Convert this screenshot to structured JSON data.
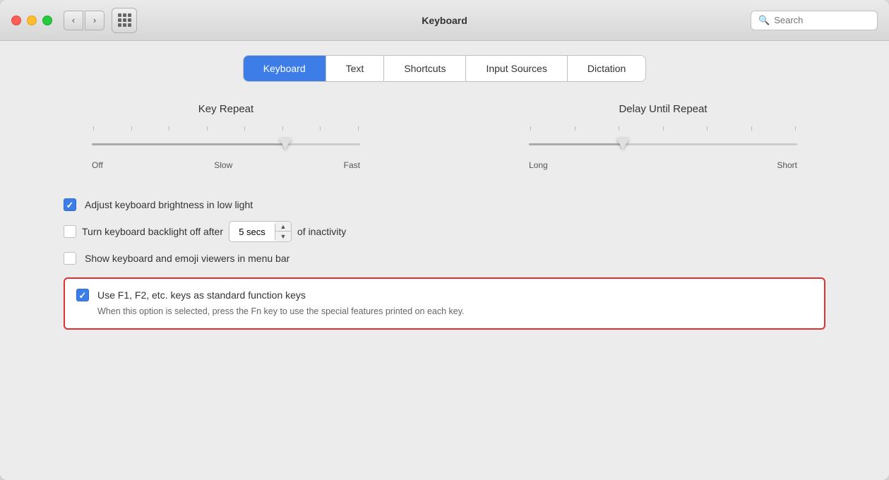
{
  "window": {
    "title": "Keyboard"
  },
  "titlebar": {
    "search_placeholder": "Search",
    "back_label": "<",
    "forward_label": ">"
  },
  "tabs": [
    {
      "id": "keyboard",
      "label": "Keyboard",
      "active": true
    },
    {
      "id": "text",
      "label": "Text",
      "active": false
    },
    {
      "id": "shortcuts",
      "label": "Shortcuts",
      "active": false
    },
    {
      "id": "input-sources",
      "label": "Input Sources",
      "active": false
    },
    {
      "id": "dictation",
      "label": "Dictation",
      "active": false
    }
  ],
  "sliders": {
    "key_repeat": {
      "label": "Key Repeat",
      "min_label": "Off",
      "mid_label": "Slow",
      "max_label": "Fast",
      "value_percent": 72
    },
    "delay_until_repeat": {
      "label": "Delay Until Repeat",
      "min_label": "Long",
      "max_label": "Short",
      "value_percent": 35
    }
  },
  "checkboxes": {
    "adjust_brightness": {
      "label": "Adjust keyboard brightness in low light",
      "checked": true
    },
    "backlight_off": {
      "label": "Turn keyboard backlight off after",
      "checked": false,
      "spinner_value": "5 secs",
      "suffix": "of inactivity"
    },
    "emoji_viewer": {
      "label": "Show keyboard and emoji viewers in menu bar",
      "checked": false
    },
    "fn_keys": {
      "label": "Use F1, F2, etc. keys as standard function keys",
      "checked": true,
      "description": "When this option is selected, press the Fn key to use the special features printed on each key."
    }
  },
  "colors": {
    "accent": "#3d7de8",
    "highlight_border": "#e03030",
    "checked_bg": "#3d7de8"
  }
}
